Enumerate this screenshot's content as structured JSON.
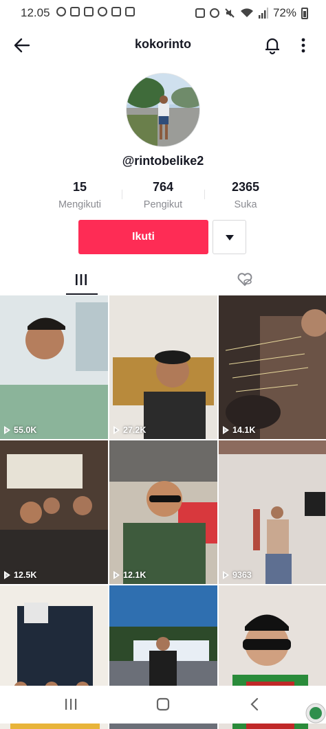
{
  "status_bar": {
    "time": "12.05",
    "battery": "72%",
    "left_icons": [
      "minus-circle-icon",
      "shopee-icon",
      "gallery-icon",
      "user-circle-icon",
      "instagram-icon",
      "record-icon"
    ],
    "right_icons": [
      "alarm-off-icon",
      "alarm-icon",
      "mute-icon",
      "wifi-icon",
      "signal-icon",
      "battery-icon"
    ]
  },
  "header": {
    "title": "kokorinto",
    "back_icon": "arrow-left-icon",
    "bell_icon": "bell-icon",
    "more_icon": "more-vertical-icon"
  },
  "profile": {
    "username": "@rintobelike2",
    "stats": [
      {
        "value": "15",
        "label": "Mengikuti"
      },
      {
        "value": "764",
        "label": "Pengikut"
      },
      {
        "value": "2365",
        "label": "Suka"
      }
    ],
    "follow_label": "Ikuti",
    "dropdown_icon": "caret-down-icon"
  },
  "tabs": [
    {
      "name": "videos",
      "icon": "grid-icon",
      "active": true
    },
    {
      "name": "liked",
      "icon": "heart-hidden-icon",
      "active": false
    }
  ],
  "videos": [
    {
      "views": "55.0K",
      "palette": [
        "#dfe6e8",
        "#8bb49a"
      ]
    },
    {
      "views": "27.2K",
      "palette": [
        "#e9e5df",
        "#2b2b2b"
      ]
    },
    {
      "views": "14.1K",
      "palette": [
        "#3a2f2a",
        "#6b5346"
      ]
    },
    {
      "views": "12.5K",
      "palette": [
        "#4d3d33",
        "#2e2a28"
      ]
    },
    {
      "views": "12.1K",
      "palette": [
        "#c9c1b4",
        "#3e5b3d"
      ]
    },
    {
      "views": "9363",
      "palette": [
        "#ded8d3",
        "#8c6b5e"
      ]
    },
    {
      "views": "",
      "palette": [
        "#f1ede6",
        "#e8b43a"
      ]
    },
    {
      "views": "",
      "palette": [
        "#2f6fb0",
        "#2d4a2a"
      ]
    },
    {
      "views": "",
      "palette": [
        "#e7e1dc",
        "#2a8b3a"
      ]
    }
  ],
  "bottom_nav": {
    "icons": [
      "recent-apps-icon",
      "home-icon",
      "back-icon"
    ]
  },
  "colors": {
    "accent": "#fe2c55",
    "text": "#161823",
    "muted": "#8a8b91"
  }
}
